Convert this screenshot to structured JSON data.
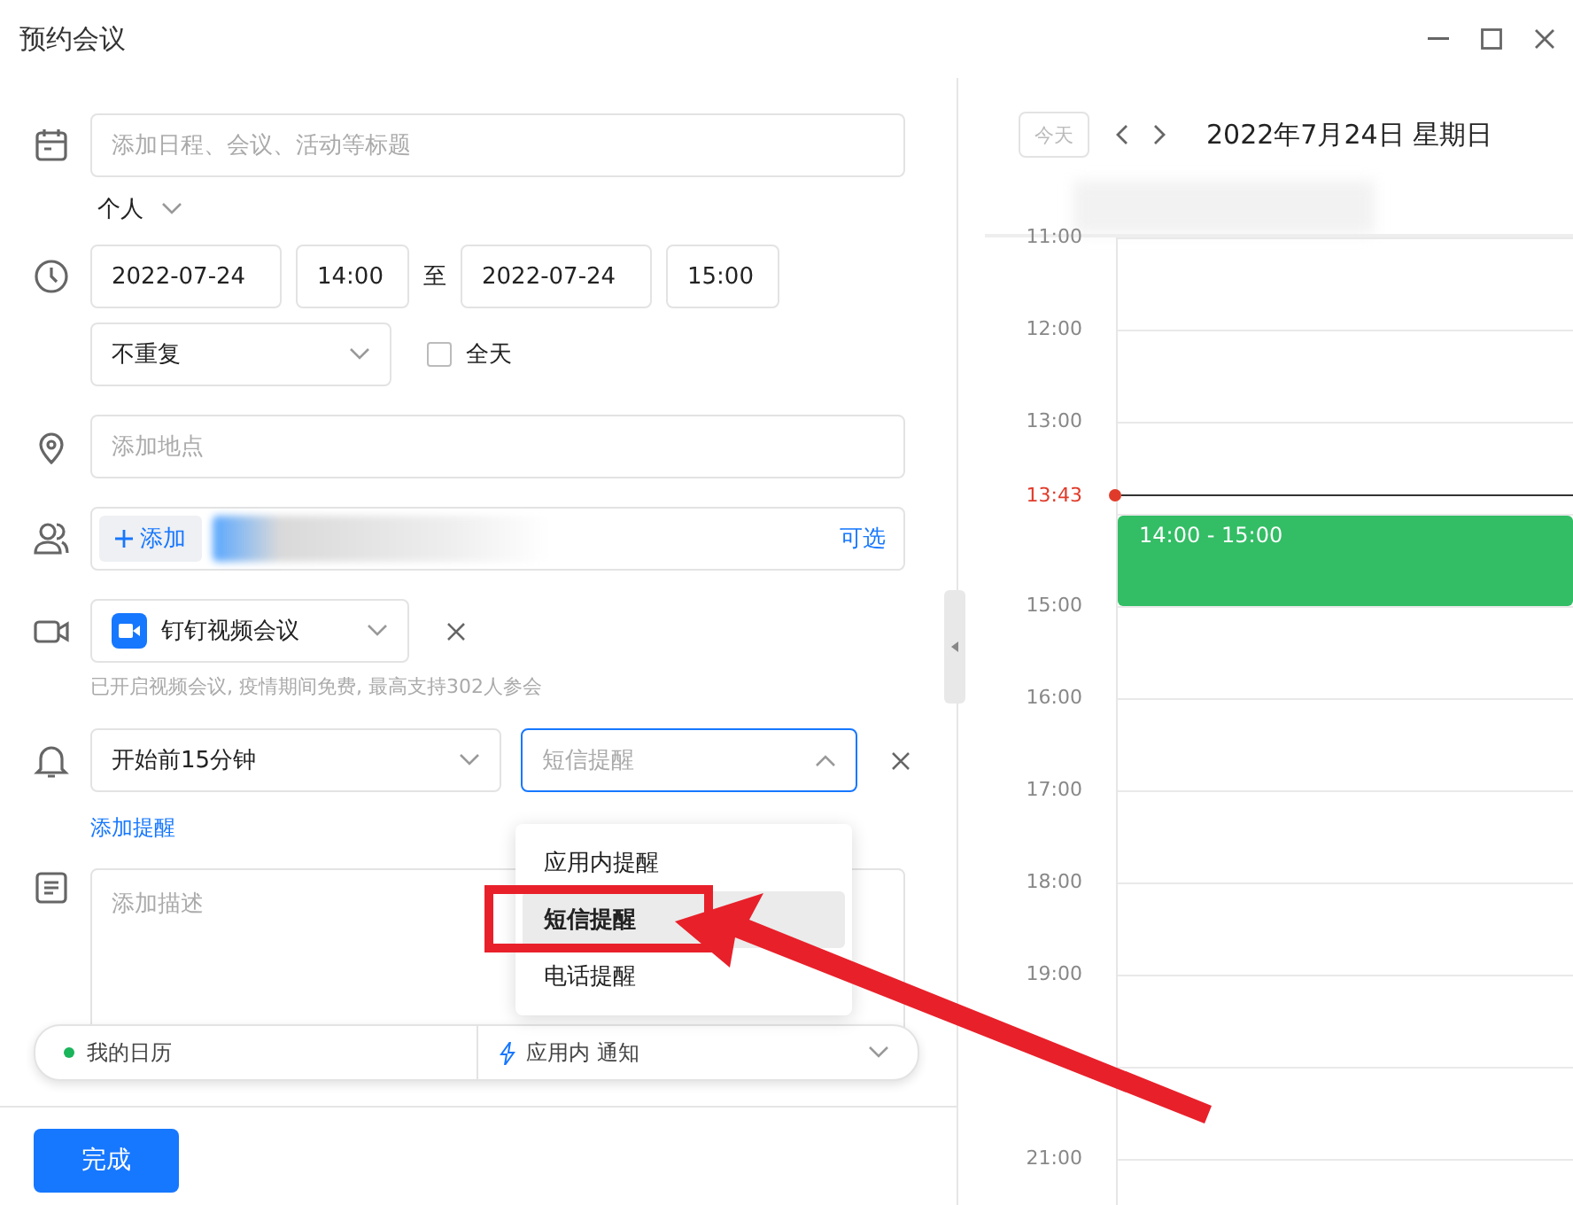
{
  "window": {
    "title": "预约会议"
  },
  "form": {
    "title_placeholder": "添加日程、会议、活动等标题",
    "calendar_type": "个人",
    "start_date": "2022-07-24",
    "start_time": "14:00",
    "separator": "至",
    "end_date": "2022-07-24",
    "end_time": "15:00",
    "repeat": "不重复",
    "all_day": {
      "label": "全天",
      "checked": false
    },
    "location_placeholder": "添加地点",
    "attendees": {
      "add_button": "添加",
      "optional": "可选"
    },
    "video": {
      "name": "钉钉视频会议",
      "note": "已开启视频会议, 疫情期间免费, 最高支持302人参会"
    },
    "reminder": {
      "time": "开始前15分钟",
      "type_placeholder": "短信提醒",
      "expanded": true,
      "options": [
        {
          "label": "应用内提醒",
          "selected": false
        },
        {
          "label": "短信提醒",
          "selected": true
        },
        {
          "label": "电话提醒",
          "selected": false
        }
      ],
      "add_link": "添加提醒"
    },
    "description_placeholder": "添加描述",
    "bottom_bar": {
      "calendar": "我的日历",
      "notify": "应用内 通知"
    },
    "done_button": "完成"
  },
  "calendar": {
    "today_button": "今天",
    "date": "2022年7月24日 星期日",
    "hour_groups": [
      [
        "11:00",
        "12:00",
        "13:00"
      ],
      [
        "15:00",
        "16:00",
        "17:00",
        "18:00",
        "19:00"
      ],
      [
        "21:00"
      ]
    ],
    "now_label": "13:43",
    "event": {
      "label": "14:00 - 15:00"
    }
  }
}
